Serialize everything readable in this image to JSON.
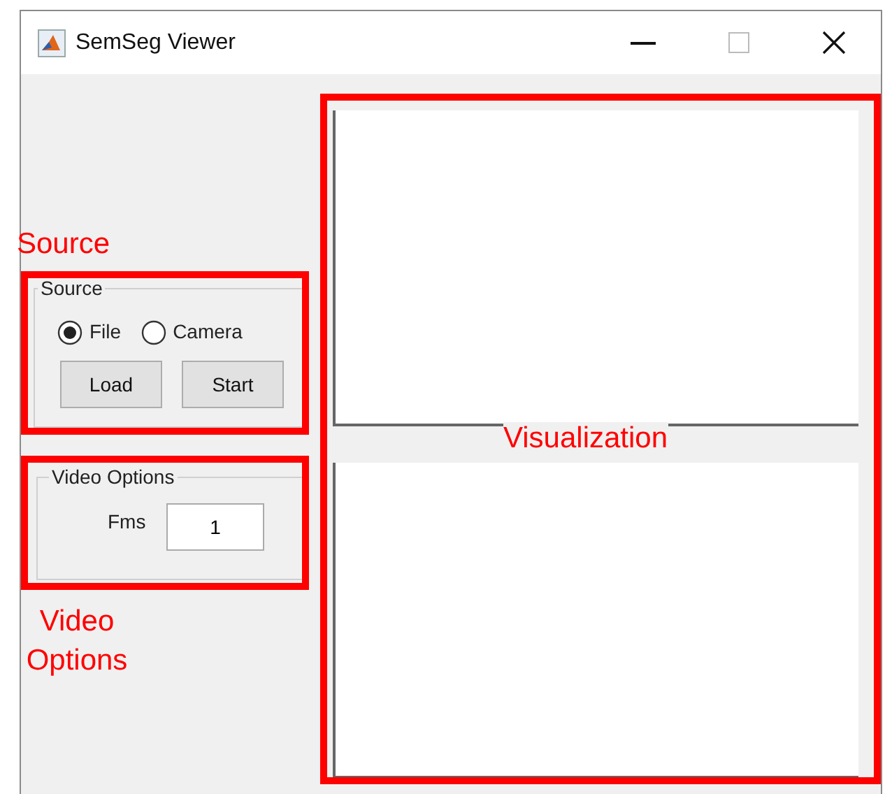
{
  "window": {
    "title": "SemSeg Viewer"
  },
  "source_panel": {
    "title": "Source",
    "options": [
      {
        "label": "File",
        "selected": true
      },
      {
        "label": "Camera",
        "selected": false
      }
    ],
    "buttons": [
      "Load",
      "Start"
    ]
  },
  "video_options_panel": {
    "title": "Video Options",
    "fields": [
      {
        "label": "Fms",
        "value": "1"
      }
    ]
  },
  "annotations": [
    {
      "label": "Source"
    },
    {
      "label": "Video Options"
    },
    {
      "label": "Visualization"
    }
  ]
}
